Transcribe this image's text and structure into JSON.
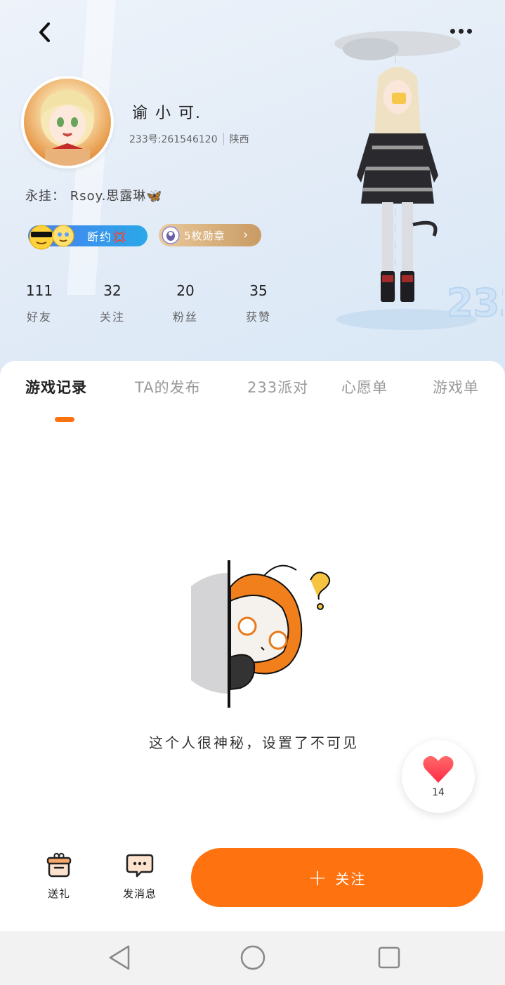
{
  "header": {
    "back_icon": "chevron-left-icon",
    "more_icon": "more-dots-icon"
  },
  "profile": {
    "nickname": "谕 小 可.",
    "uid": "233号:261546120",
    "location": "陕西",
    "signature": "永挂： Rsoy.思露琳🦋",
    "status_label": "断约💢",
    "badge_label": "5枚勋章"
  },
  "stats": [
    {
      "value": "111",
      "label": "好友"
    },
    {
      "value": "32",
      "label": "关注"
    },
    {
      "value": "20",
      "label": "粉丝"
    },
    {
      "value": "35",
      "label": "获赞"
    }
  ],
  "tabs": [
    {
      "label": "游戏记录",
      "active": true
    },
    {
      "label": "TA的发布",
      "active": false
    },
    {
      "label": "233派对",
      "active": false
    },
    {
      "label": "心愿单",
      "active": false
    },
    {
      "label": "游戏单",
      "active": false
    }
  ],
  "empty_state": {
    "message": "这个人很神秘，设置了不可见"
  },
  "like": {
    "count": "14",
    "icon": "heart-icon"
  },
  "actions": {
    "gift_label": "送礼",
    "message_label": "发消息",
    "follow_label": "关注"
  },
  "colors": {
    "accent": "#ff7210",
    "status_gradient_start": "#4a7ff0",
    "status_gradient_end": "#2aa8e8",
    "badge_gold": "#c99a64",
    "heart": "#ff3b50"
  }
}
